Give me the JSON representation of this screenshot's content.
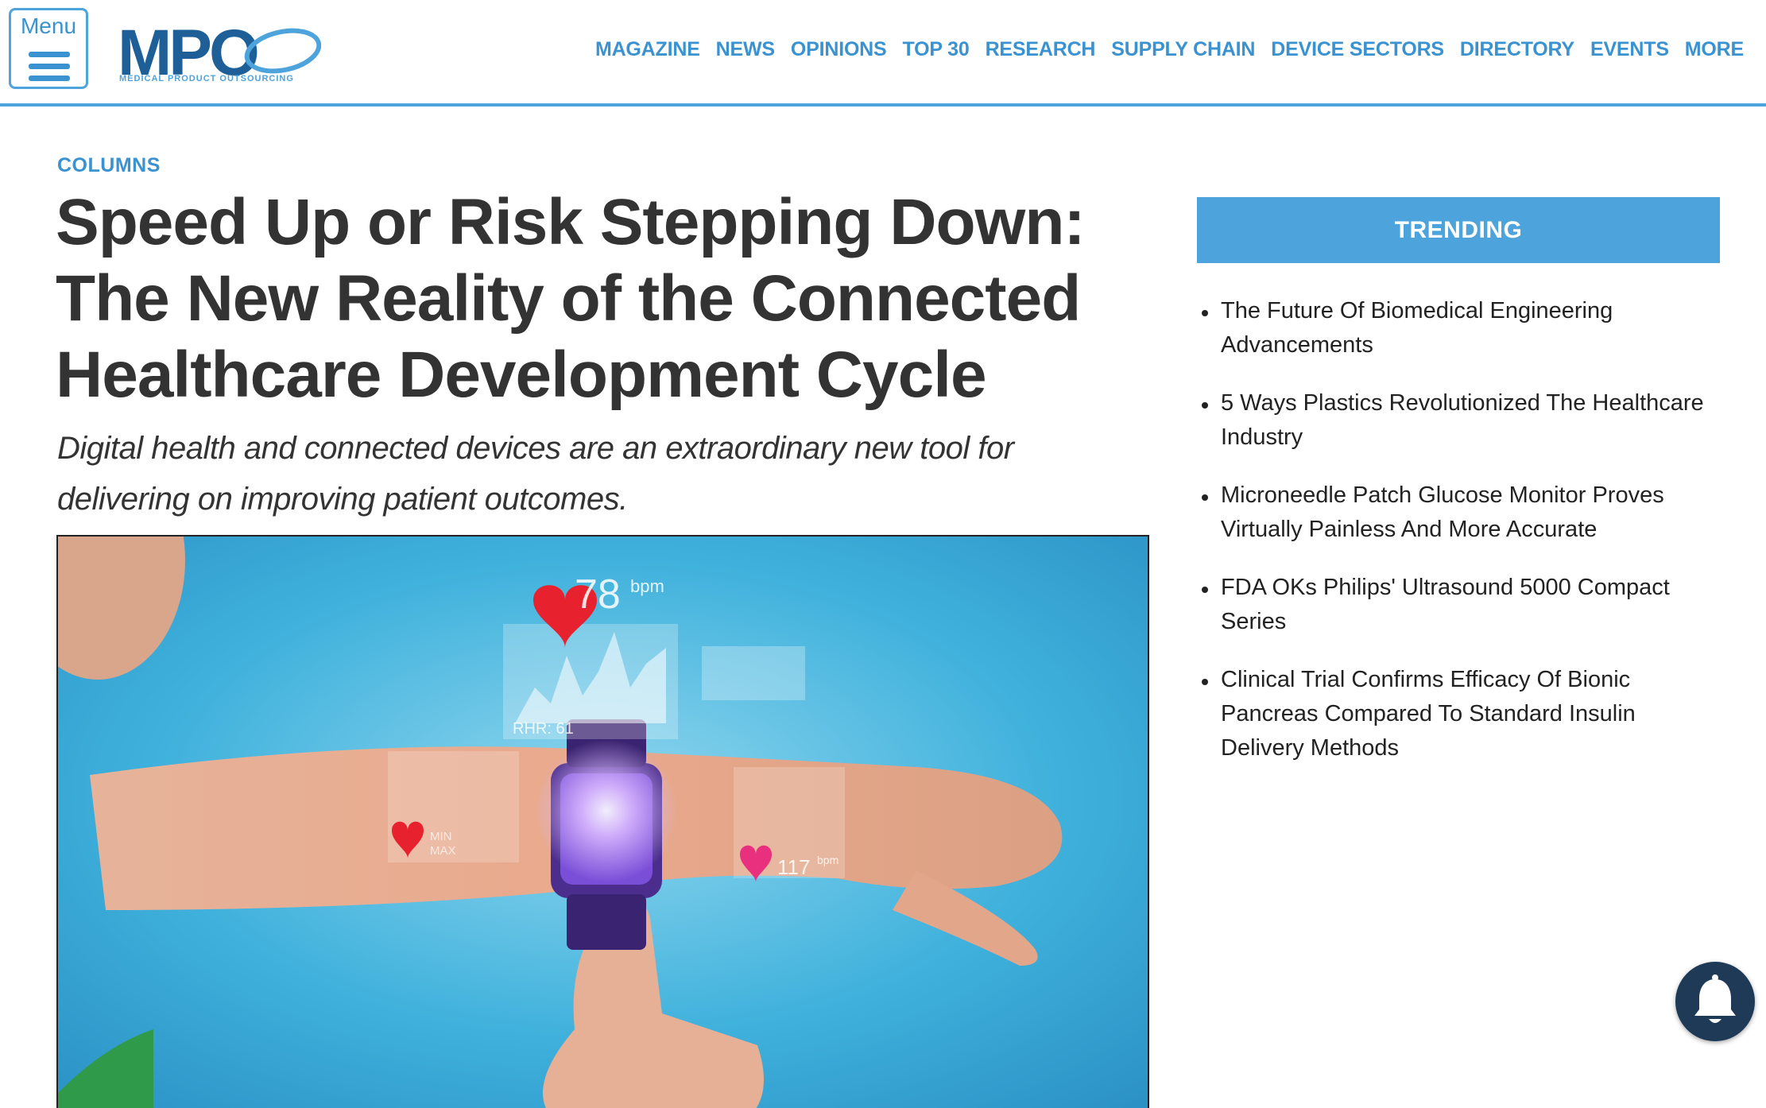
{
  "header": {
    "menu_label": "Menu",
    "logo_text": "MPO",
    "logo_tagline": "MEDICAL PRODUCT OUTSOURCING",
    "nav": [
      "MAGAZINE",
      "NEWS",
      "OPINIONS",
      "TOP 30",
      "RESEARCH",
      "SUPPLY CHAIN",
      "DEVICE SECTORS",
      "DIRECTORY",
      "EVENTS",
      "MORE"
    ]
  },
  "article": {
    "section": "COLUMNS",
    "title": "Speed Up or Risk Stepping Down: The New Reality of the Connected Healthcare Development Cycle",
    "subtitle": "Digital health and connected devices are an extraordinary new tool for delivering on improving patient outcomes.",
    "hero_overlay": {
      "heart_rate_value": "78",
      "heart_rate_unit": "bpm",
      "rhr_label": "RHR: 61",
      "min_label": "MIN",
      "max_label": "MAX",
      "second_rate_value": "117",
      "second_rate_unit": "bpm"
    }
  },
  "sidebar": {
    "trending_title": "TRENDING",
    "trending_items": [
      "The Future Of Biomedical Engineering Advancements",
      "5 Ways Plastics Revolutionized The Healthcare Industry",
      "Microneedle Patch Glucose Monitor Proves Virtually Painless And More Accurate",
      "FDA OKs Philips' Ultrasound 5000 Compact Series",
      "Clinical Trial Confirms Efficacy Of Bionic Pancreas Compared To Standard Insulin Delivery Methods"
    ]
  },
  "colors": {
    "brand_blue": "#4da3dc",
    "link_blue": "#3a93d0",
    "notification_bg": "#1f3a57"
  },
  "icons": {
    "menu": "hamburger-icon",
    "notification": "bell-icon"
  }
}
